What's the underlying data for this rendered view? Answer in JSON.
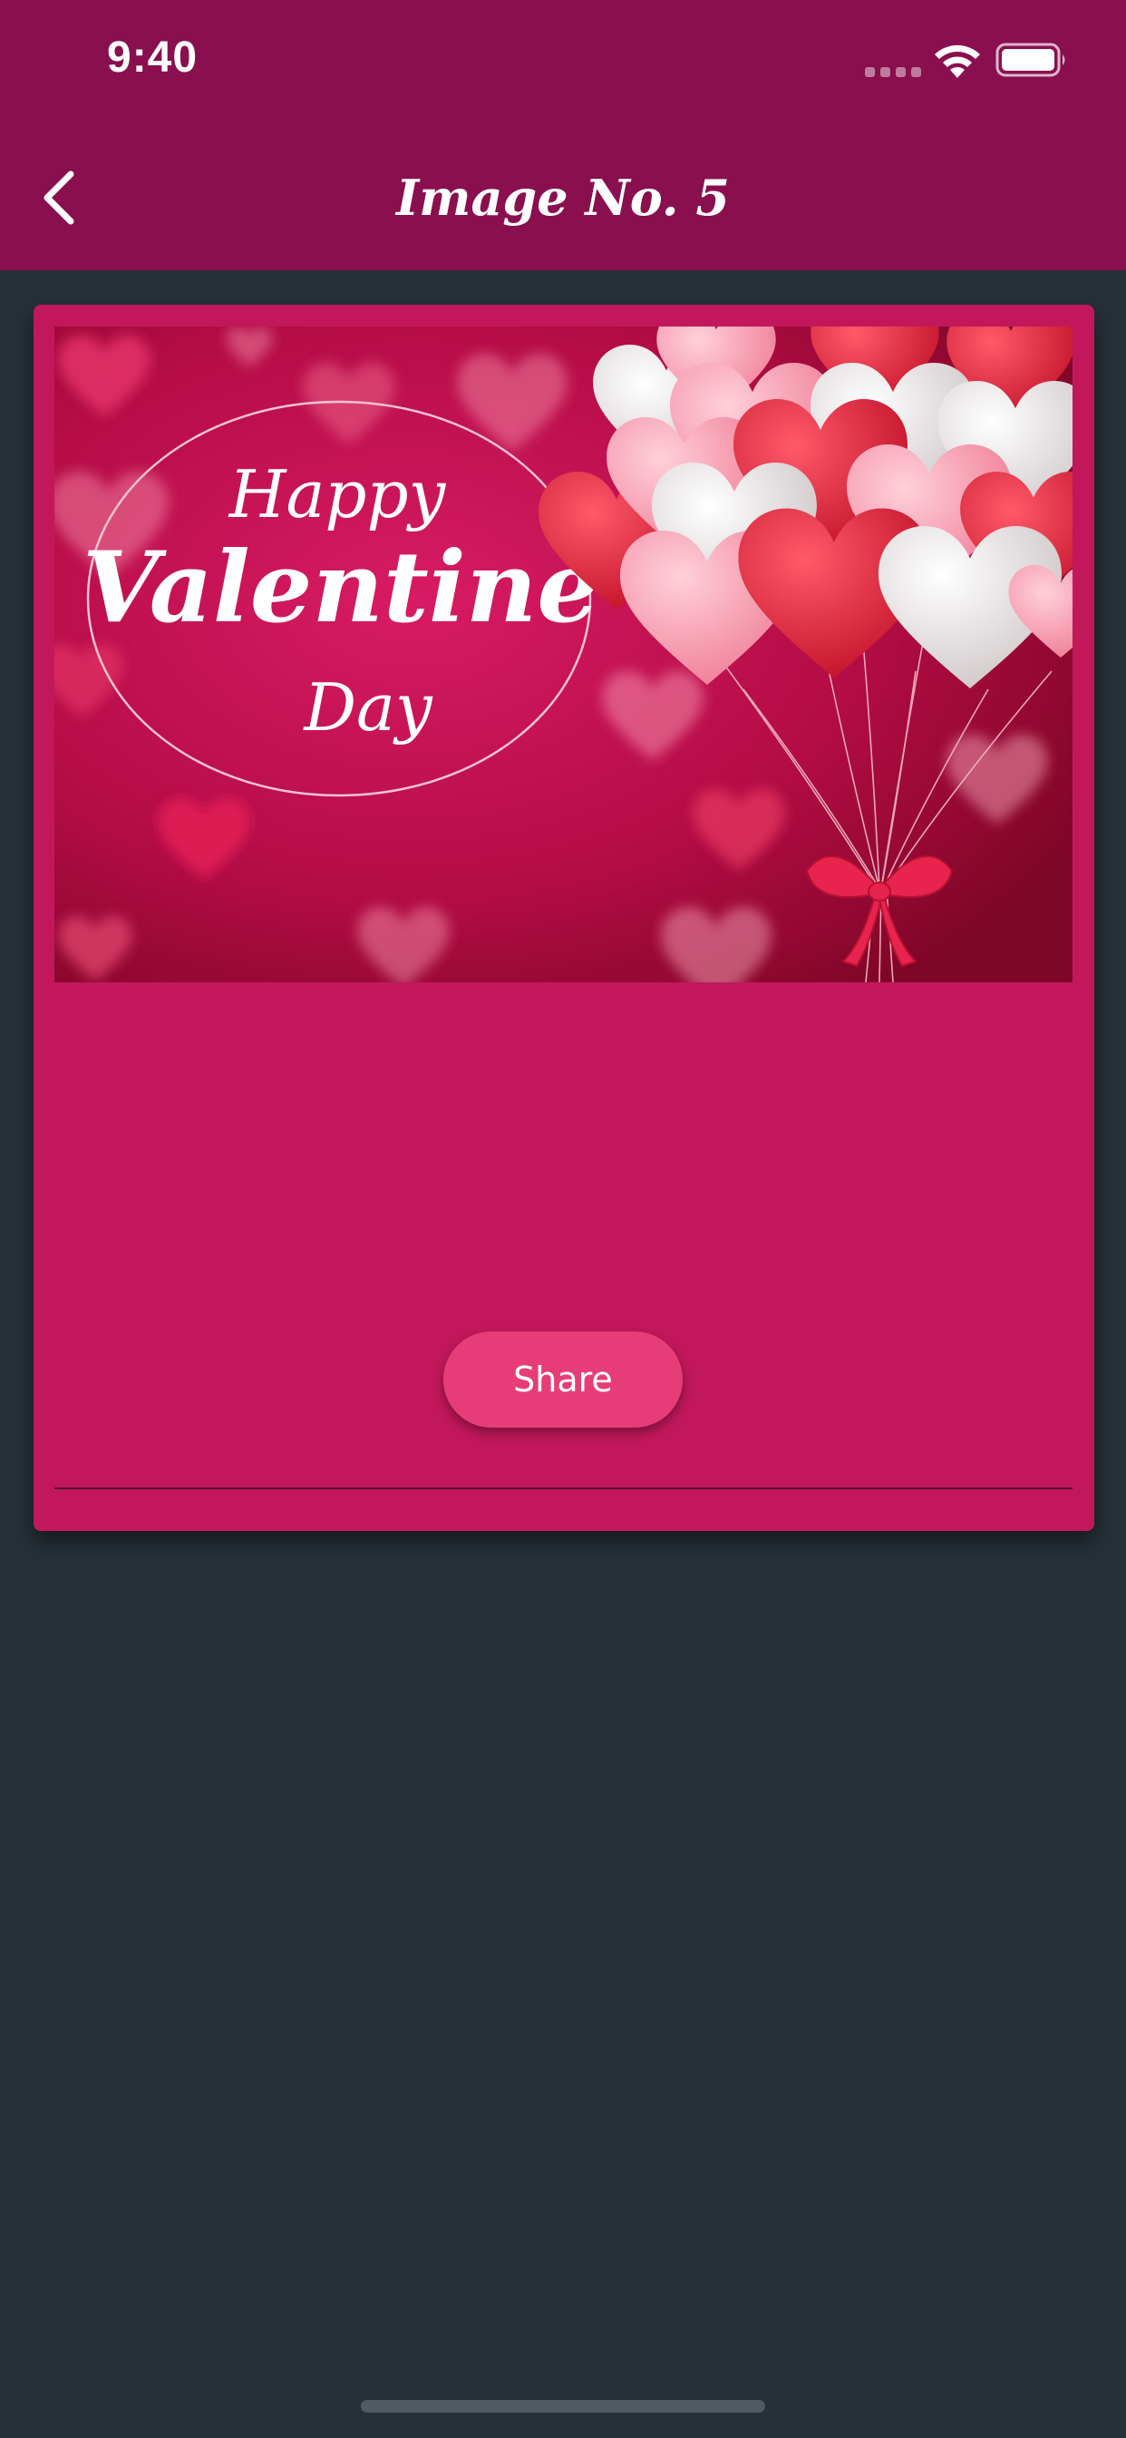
{
  "status_bar": {
    "time": "9:40",
    "icons": [
      "signal-dots-icon",
      "wifi-icon",
      "battery-icon"
    ]
  },
  "nav": {
    "back_icon": "chevron-left-icon",
    "title": "Image No. 5"
  },
  "card": {
    "image": {
      "greeting_line1": "Happy",
      "greeting_line2": "Valentine",
      "greeting_line3": "Day"
    },
    "share_label": "Share"
  },
  "colors": {
    "header": "#8a0f4f",
    "background": "#263037",
    "card": "#c2185b",
    "button": "#e63d78"
  }
}
